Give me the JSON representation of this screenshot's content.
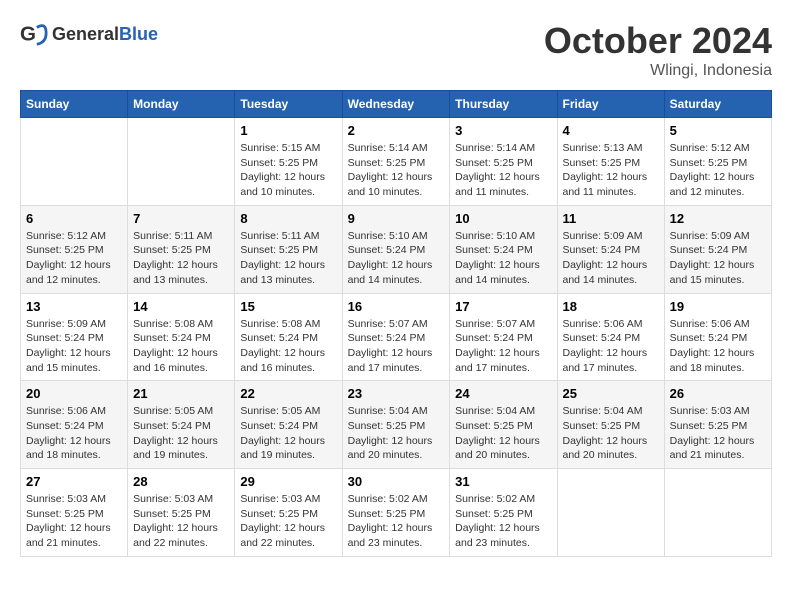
{
  "header": {
    "logo": {
      "general": "General",
      "blue": "Blue"
    },
    "title": "October 2024",
    "location": "Wlingi, Indonesia"
  },
  "weekdays": [
    "Sunday",
    "Monday",
    "Tuesday",
    "Wednesday",
    "Thursday",
    "Friday",
    "Saturday"
  ],
  "weeks": [
    [
      null,
      null,
      {
        "day": 1,
        "sunrise": "Sunrise: 5:15 AM",
        "sunset": "Sunset: 5:25 PM",
        "daylight": "Daylight: 12 hours and 10 minutes."
      },
      {
        "day": 2,
        "sunrise": "Sunrise: 5:14 AM",
        "sunset": "Sunset: 5:25 PM",
        "daylight": "Daylight: 12 hours and 10 minutes."
      },
      {
        "day": 3,
        "sunrise": "Sunrise: 5:14 AM",
        "sunset": "Sunset: 5:25 PM",
        "daylight": "Daylight: 12 hours and 11 minutes."
      },
      {
        "day": 4,
        "sunrise": "Sunrise: 5:13 AM",
        "sunset": "Sunset: 5:25 PM",
        "daylight": "Daylight: 12 hours and 11 minutes."
      },
      {
        "day": 5,
        "sunrise": "Sunrise: 5:12 AM",
        "sunset": "Sunset: 5:25 PM",
        "daylight": "Daylight: 12 hours and 12 minutes."
      }
    ],
    [
      {
        "day": 6,
        "sunrise": "Sunrise: 5:12 AM",
        "sunset": "Sunset: 5:25 PM",
        "daylight": "Daylight: 12 hours and 12 minutes."
      },
      {
        "day": 7,
        "sunrise": "Sunrise: 5:11 AM",
        "sunset": "Sunset: 5:25 PM",
        "daylight": "Daylight: 12 hours and 13 minutes."
      },
      {
        "day": 8,
        "sunrise": "Sunrise: 5:11 AM",
        "sunset": "Sunset: 5:25 PM",
        "daylight": "Daylight: 12 hours and 13 minutes."
      },
      {
        "day": 9,
        "sunrise": "Sunrise: 5:10 AM",
        "sunset": "Sunset: 5:24 PM",
        "daylight": "Daylight: 12 hours and 14 minutes."
      },
      {
        "day": 10,
        "sunrise": "Sunrise: 5:10 AM",
        "sunset": "Sunset: 5:24 PM",
        "daylight": "Daylight: 12 hours and 14 minutes."
      },
      {
        "day": 11,
        "sunrise": "Sunrise: 5:09 AM",
        "sunset": "Sunset: 5:24 PM",
        "daylight": "Daylight: 12 hours and 14 minutes."
      },
      {
        "day": 12,
        "sunrise": "Sunrise: 5:09 AM",
        "sunset": "Sunset: 5:24 PM",
        "daylight": "Daylight: 12 hours and 15 minutes."
      }
    ],
    [
      {
        "day": 13,
        "sunrise": "Sunrise: 5:09 AM",
        "sunset": "Sunset: 5:24 PM",
        "daylight": "Daylight: 12 hours and 15 minutes."
      },
      {
        "day": 14,
        "sunrise": "Sunrise: 5:08 AM",
        "sunset": "Sunset: 5:24 PM",
        "daylight": "Daylight: 12 hours and 16 minutes."
      },
      {
        "day": 15,
        "sunrise": "Sunrise: 5:08 AM",
        "sunset": "Sunset: 5:24 PM",
        "daylight": "Daylight: 12 hours and 16 minutes."
      },
      {
        "day": 16,
        "sunrise": "Sunrise: 5:07 AM",
        "sunset": "Sunset: 5:24 PM",
        "daylight": "Daylight: 12 hours and 17 minutes."
      },
      {
        "day": 17,
        "sunrise": "Sunrise: 5:07 AM",
        "sunset": "Sunset: 5:24 PM",
        "daylight": "Daylight: 12 hours and 17 minutes."
      },
      {
        "day": 18,
        "sunrise": "Sunrise: 5:06 AM",
        "sunset": "Sunset: 5:24 PM",
        "daylight": "Daylight: 12 hours and 17 minutes."
      },
      {
        "day": 19,
        "sunrise": "Sunrise: 5:06 AM",
        "sunset": "Sunset: 5:24 PM",
        "daylight": "Daylight: 12 hours and 18 minutes."
      }
    ],
    [
      {
        "day": 20,
        "sunrise": "Sunrise: 5:06 AM",
        "sunset": "Sunset: 5:24 PM",
        "daylight": "Daylight: 12 hours and 18 minutes."
      },
      {
        "day": 21,
        "sunrise": "Sunrise: 5:05 AM",
        "sunset": "Sunset: 5:24 PM",
        "daylight": "Daylight: 12 hours and 19 minutes."
      },
      {
        "day": 22,
        "sunrise": "Sunrise: 5:05 AM",
        "sunset": "Sunset: 5:24 PM",
        "daylight": "Daylight: 12 hours and 19 minutes."
      },
      {
        "day": 23,
        "sunrise": "Sunrise: 5:04 AM",
        "sunset": "Sunset: 5:25 PM",
        "daylight": "Daylight: 12 hours and 20 minutes."
      },
      {
        "day": 24,
        "sunrise": "Sunrise: 5:04 AM",
        "sunset": "Sunset: 5:25 PM",
        "daylight": "Daylight: 12 hours and 20 minutes."
      },
      {
        "day": 25,
        "sunrise": "Sunrise: 5:04 AM",
        "sunset": "Sunset: 5:25 PM",
        "daylight": "Daylight: 12 hours and 20 minutes."
      },
      {
        "day": 26,
        "sunrise": "Sunrise: 5:03 AM",
        "sunset": "Sunset: 5:25 PM",
        "daylight": "Daylight: 12 hours and 21 minutes."
      }
    ],
    [
      {
        "day": 27,
        "sunrise": "Sunrise: 5:03 AM",
        "sunset": "Sunset: 5:25 PM",
        "daylight": "Daylight: 12 hours and 21 minutes."
      },
      {
        "day": 28,
        "sunrise": "Sunrise: 5:03 AM",
        "sunset": "Sunset: 5:25 PM",
        "daylight": "Daylight: 12 hours and 22 minutes."
      },
      {
        "day": 29,
        "sunrise": "Sunrise: 5:03 AM",
        "sunset": "Sunset: 5:25 PM",
        "daylight": "Daylight: 12 hours and 22 minutes."
      },
      {
        "day": 30,
        "sunrise": "Sunrise: 5:02 AM",
        "sunset": "Sunset: 5:25 PM",
        "daylight": "Daylight: 12 hours and 23 minutes."
      },
      {
        "day": 31,
        "sunrise": "Sunrise: 5:02 AM",
        "sunset": "Sunset: 5:25 PM",
        "daylight": "Daylight: 12 hours and 23 minutes."
      },
      null,
      null
    ]
  ]
}
